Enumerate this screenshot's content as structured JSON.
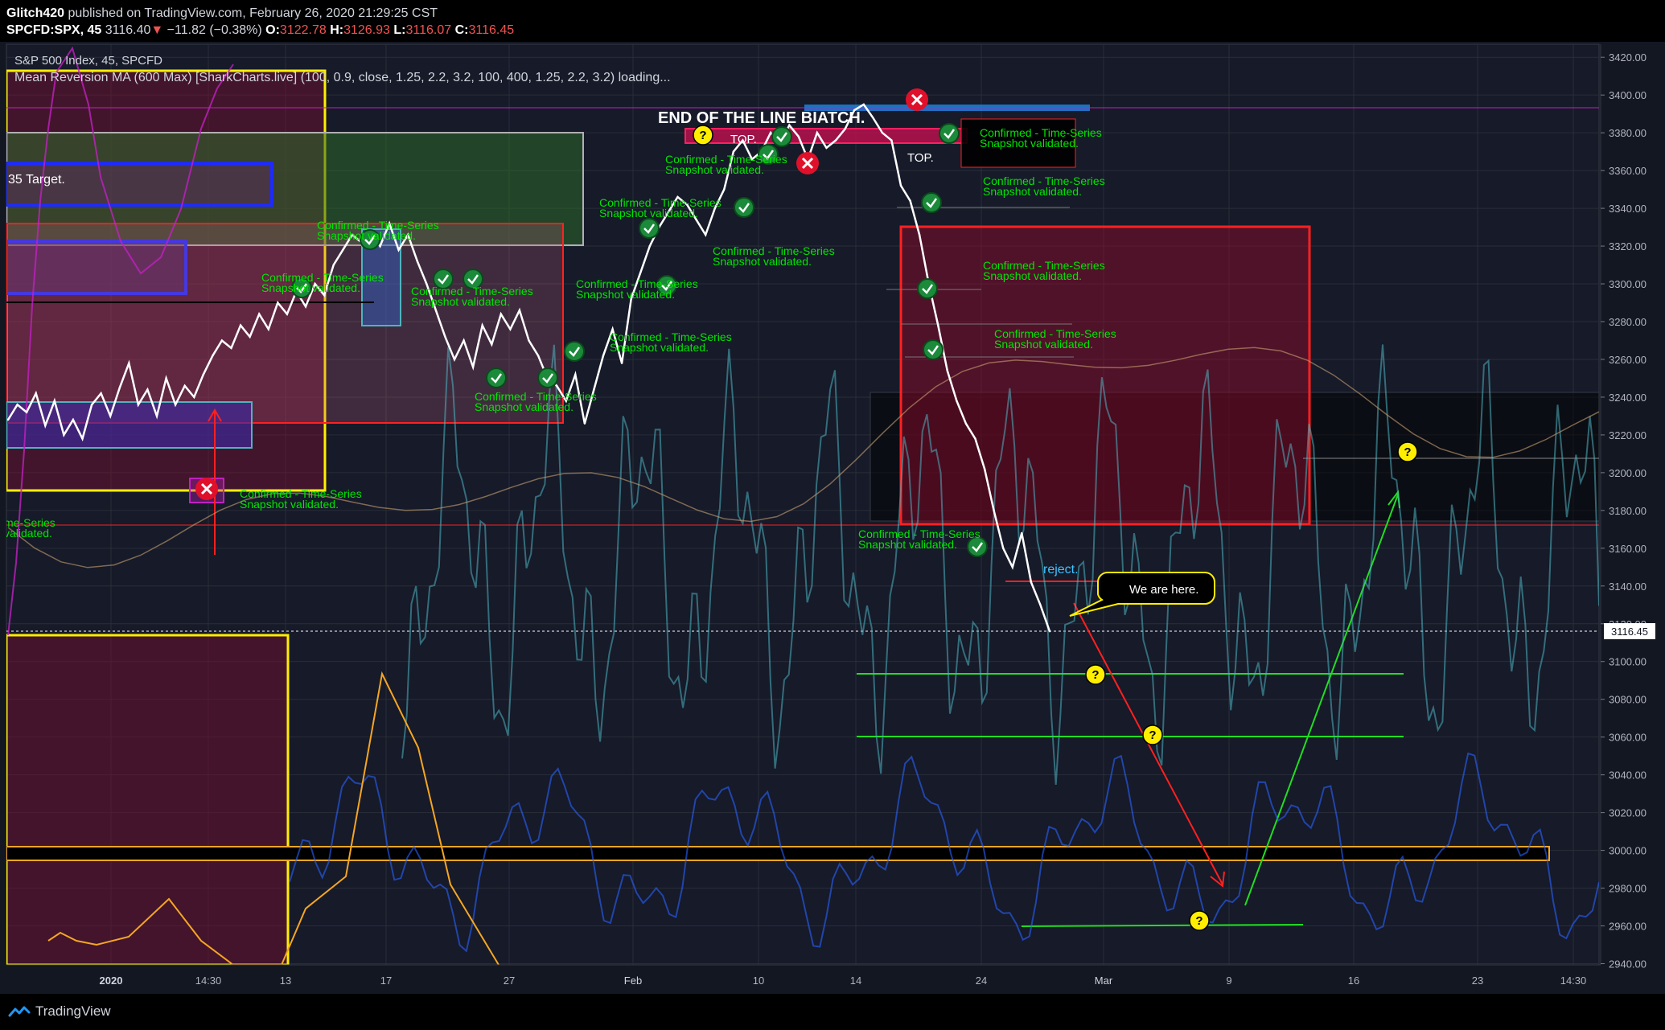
{
  "header": {
    "author": "Glitch420",
    "published_text": " published on TradingView.com, February 26, 2020 21:29:25 CST",
    "symbol": "SPCFD:SPX, 45",
    "price": "3116.40",
    "change_arrow": "▼",
    "change": "−11.82 (−0.38%)",
    "o_label": "O:",
    "o_value": "3122.78",
    "h_label": "H:",
    "h_value": "3126.93",
    "l_label": "L:",
    "l_value": "3116.07",
    "c_label": "C:",
    "c_value": "3116.45"
  },
  "legend": {
    "symbol_title": "S&P 500 Index, 45, SPCFD",
    "indicator": "Mean Reversion MA (600 Max) [SharkCharts.live] (100, 0.9, close, 1.25, 2.2, 3.2, 100, 400, 1.25, 2.2, 3.2) loading..."
  },
  "annotations": {
    "main_title": "END OF THE LINE BIATCH.",
    "target_label": "35 Target.",
    "top_label_1": "TOP.",
    "top_label_2": "TOP.",
    "reject_label": "reject.",
    "callout": "We are here.",
    "confirmed_1": "Confirmed - Time-Series",
    "confirmed_2": "Snapshot validated.",
    "confirmed_full": "Confirmed - Time-Series Snapshot validated.",
    "left_edge_1": "me-Series",
    "left_edge_2": "validated.",
    "question": "?"
  },
  "colors": {
    "price_line": "#ffffff",
    "teal_line": "#4fb3bf",
    "blue_line": "#2962ff",
    "orange_line": "#f5a623",
    "purple_line": "#c020c0",
    "green_annotation": "#00e600",
    "red_box": "#ff2020",
    "yellow_box": "#ffee00",
    "grid": "#2a2e39"
  },
  "footer": {
    "brand": "TradingView"
  },
  "chart_data": {
    "type": "line",
    "title": "S&P 500 Index, 45, SPCFD",
    "y_axis_position": "right",
    "ylim": [
      2940,
      3425
    ],
    "y_ticks": [
      "3420.00",
      "3400.00",
      "3380.00",
      "3360.00",
      "3340.00",
      "3320.00",
      "3300.00",
      "3280.00",
      "3260.00",
      "3240.00",
      "3220.00",
      "3200.00",
      "3180.00",
      "3160.00",
      "3140.00",
      "3120.00",
      "3100.00",
      "3080.00",
      "3060.00",
      "3040.00",
      "3020.00",
      "3000.00",
      "2980.00",
      "2960.00",
      "2940.00"
    ],
    "x_ticks": [
      "2020",
      "14:30",
      "13",
      "17",
      "27",
      "Feb",
      "10",
      "14",
      "24",
      "Mar",
      "9",
      "16",
      "23",
      "14:30"
    ],
    "last_price_label": "3116.45",
    "grid": true,
    "series": [
      {
        "values": [
          3228,
          3236,
          3232,
          3242,
          3225,
          3238,
          3220,
          3228,
          3218,
          3236,
          3242,
          3230,
          3245,
          3258,
          3236,
          3244,
          3230,
          3250,
          3236,
          3246,
          3240,
          3252,
          3262,
          3270,
          3266,
          3278,
          3272,
          3284,
          3276,
          3290,
          3284,
          3296,
          3288,
          3300,
          3294,
          3310,
          3318,
          3326,
          3322,
          3328,
          3320,
          3332,
          3318,
          3326,
          3312,
          3300,
          3286,
          3272,
          3260,
          3270,
          3256,
          3278,
          3268,
          3284,
          3276,
          3286,
          3270,
          3262,
          3250,
          3246,
          3238,
          3252,
          3226,
          3244,
          3262,
          3276,
          3258,
          3292,
          3306,
          3320,
          3330,
          3338,
          3346,
          3342,
          3334,
          3326,
          3340,
          3350,
          3370,
          3376,
          3366,
          3370,
          3380,
          3374,
          3384,
          3378,
          3366,
          3380,
          3372,
          3376,
          3382,
          3392,
          3395,
          3388,
          3380,
          3376,
          3352,
          3344,
          3326,
          3300,
          3278,
          3254,
          3238,
          3226,
          3218,
          3202,
          3180,
          3160,
          3150,
          3168,
          3142,
          3130,
          3116
        ]
      }
    ]
  }
}
